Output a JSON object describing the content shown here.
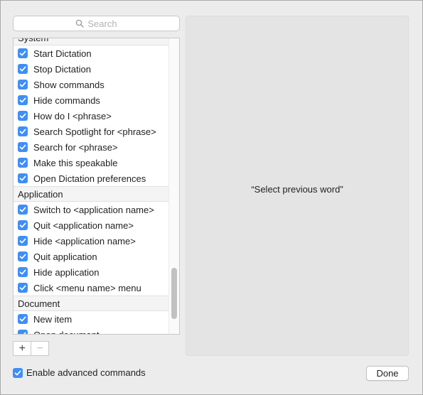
{
  "search": {
    "placeholder": "Search"
  },
  "sections": [
    {
      "header": "System",
      "items": [
        "Start Dictation",
        "Stop Dictation",
        "Show commands",
        "Hide commands",
        "How do I <phrase>",
        "Search Spotlight for <phrase>",
        "Search for <phrase>",
        "Make this speakable",
        "Open Dictation preferences"
      ]
    },
    {
      "header": "Application",
      "items": [
        "Switch to <application name>",
        "Quit <application name>",
        "Hide <application name>",
        "Quit application",
        "Hide application",
        "Click <menu name> menu"
      ]
    },
    {
      "header": "Document",
      "items": [
        "New item",
        "Open document"
      ]
    }
  ],
  "add_button": "+",
  "remove_button": "−",
  "preview": {
    "text": "“Select previous word”"
  },
  "enable_advanced": {
    "label": "Enable advanced commands",
    "checked": true
  },
  "done_button": "Done",
  "colors": {
    "accent": "#3e8ef7",
    "window_bg": "#ececec",
    "preview_bg": "#e4e4e4"
  }
}
